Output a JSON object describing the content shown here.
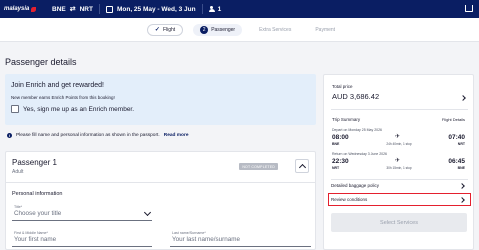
{
  "header": {
    "logo": "malaysia",
    "origin": "BNE",
    "destination": "NRT",
    "dates": "Mon, 25 May - Wed, 3 Jun",
    "passengers": "1"
  },
  "steps": [
    {
      "label": "Flight",
      "state": "done"
    },
    {
      "number": "2",
      "label": "Passenger",
      "state": "active"
    },
    {
      "label": "Extra Services",
      "state": "pending"
    },
    {
      "label": "Payment",
      "state": "pending"
    }
  ],
  "page_title": "Passenger details",
  "enrich": {
    "heading": "Join Enrich and get rewarded!",
    "subtext": "New member earns Enrich Points from this booking!",
    "checkbox_label": "Yes, sign me up as an Enrich member."
  },
  "info": {
    "text": "Please fill name and personal information as shown in the passport.",
    "link": "Read more"
  },
  "passenger_card": {
    "name": "Passenger 1",
    "type": "Adult",
    "status": "NOT COMPLETED",
    "section": "Personal information",
    "title_field": {
      "label": "Title*",
      "placeholder": "Choose your title"
    },
    "first_name": {
      "label": "First & Middle Name*",
      "placeholder": "Your first name"
    },
    "last_name": {
      "label": "Last name/Surname*",
      "placeholder": "Your last name/surname"
    }
  },
  "summary": {
    "total_label": "Total price",
    "total_value": "AUD 3,686.42",
    "trip_summary": "Trip Summary",
    "flight_details": "Flight Details",
    "depart": {
      "label": "Depart on Monday 25 May 2026",
      "dep_time": "08:00",
      "dep_code": "BNE",
      "arr_time": "07:40",
      "arr_code": "NRT",
      "duration": "24h 40min, 1 stop"
    },
    "return": {
      "label": "Return on Wednesday 3 June 2026",
      "dep_time": "22:30",
      "dep_code": "NRT",
      "arr_time": "06:45",
      "arr_code": "BNE",
      "duration": "30h 15min, 1 stop"
    },
    "baggage": "Detailed baggage policy",
    "review": "Review conditions",
    "select_button": "Select Services"
  }
}
